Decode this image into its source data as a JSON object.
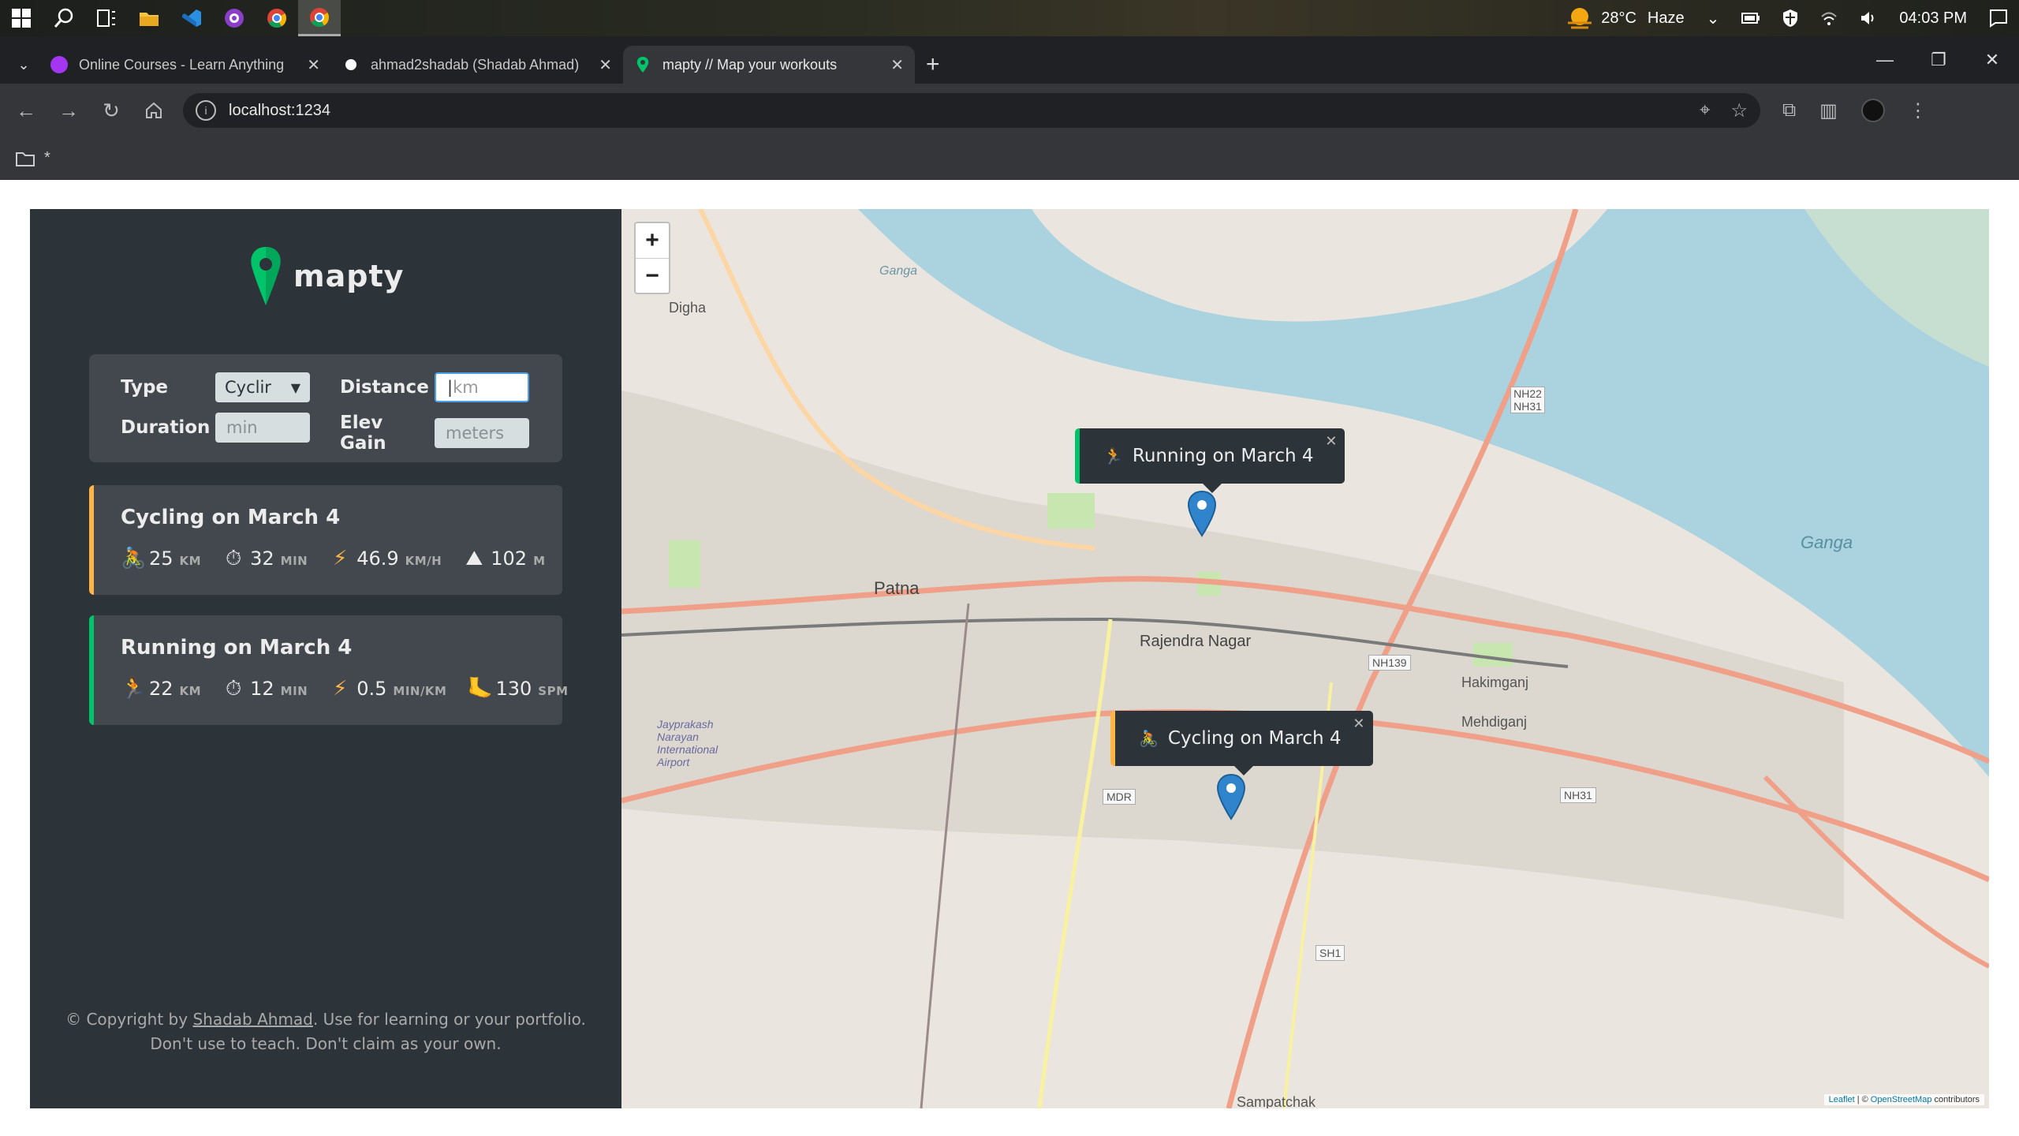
{
  "taskbar": {
    "weather_temp": "28°C",
    "weather_desc": "Haze",
    "time": "04:03 PM"
  },
  "tabs": [
    {
      "title": "Online Courses - Learn Anything",
      "favicon": "udemy-icon",
      "color": "#a435f0"
    },
    {
      "title": "ahmad2shadab (Shadab Ahmad)",
      "favicon": "github-icon",
      "color": "#ffffff"
    },
    {
      "title": "mapty // Map your workouts",
      "favicon": "map-pin-icon",
      "color": "#00c46a"
    }
  ],
  "address": {
    "url": "localhost:1234"
  },
  "bookmarks": {
    "folder_label": "*"
  },
  "app": {
    "name": "mapty",
    "brand_green": "#00c46a",
    "brand_yellow": "#ffb545"
  },
  "form": {
    "type_label": "Type",
    "type_value": "Cyclir",
    "distance_label": "Distance",
    "distance_placeholder": "km",
    "duration_label": "Duration",
    "duration_placeholder": "min",
    "elev_label": "Elev Gain",
    "elev_placeholder": "meters"
  },
  "workouts": [
    {
      "type": "cycling",
      "title": "Cycling on March 4",
      "stats": [
        {
          "icon": "bicycle-icon",
          "glyph": "🚴",
          "value": "25",
          "unit": "KM"
        },
        {
          "icon": "stopwatch-icon",
          "glyph": "⏱",
          "value": "32",
          "unit": "MIN"
        },
        {
          "icon": "lightning-icon",
          "glyph": "⚡",
          "value": "46.9",
          "unit": "KM/H"
        },
        {
          "icon": "mountain-icon",
          "glyph": "⛰",
          "value": "102",
          "unit": "M"
        }
      ]
    },
    {
      "type": "running",
      "title": "Running on March 4",
      "stats": [
        {
          "icon": "runner-icon",
          "glyph": "🏃",
          "value": "22",
          "unit": "KM"
        },
        {
          "icon": "stopwatch-icon",
          "glyph": "⏱",
          "value": "12",
          "unit": "MIN"
        },
        {
          "icon": "lightning-icon",
          "glyph": "⚡",
          "value": "0.5",
          "unit": "MIN/KM"
        },
        {
          "icon": "footprint-icon",
          "glyph": "🦶",
          "value": "130",
          "unit": "SPM"
        }
      ]
    }
  ],
  "footer": {
    "copyright_prefix": "© Copyright by",
    "author": "Shadab Ahmad",
    "copyright_suffix": ". Use for learning or your portfolio.",
    "line2": "Don't use to teach. Don't claim as your own."
  },
  "map": {
    "zoom_in": "+",
    "zoom_out": "−",
    "popups": [
      {
        "type": "running",
        "text": "Running on March 4",
        "glyph": "🏃"
      },
      {
        "type": "cycling",
        "text": "Cycling on March 4",
        "glyph": "🚴"
      }
    ],
    "labels": {
      "patna": "Patna",
      "rajendra_nagar": "Rajendra Nagar",
      "ganga_river": "Ganga",
      "ganga_top": "Ganga",
      "digha": "Digha",
      "hakimganj": "Hakimganj",
      "mehdiganj": "Mehdiganj",
      "airport": "Jayprakash Narayan International Airport",
      "sampatchak": "Sampatchak",
      "nh22": "NH22 NH31",
      "nh139": "NH139",
      "nh31": "NH31",
      "mdr": "MDR",
      "sh1": "SH1"
    },
    "attribution_leaflet": "Leaflet",
    "attribution_osm": "OpenStreetMap",
    "attribution_suffix": "contributors"
  }
}
